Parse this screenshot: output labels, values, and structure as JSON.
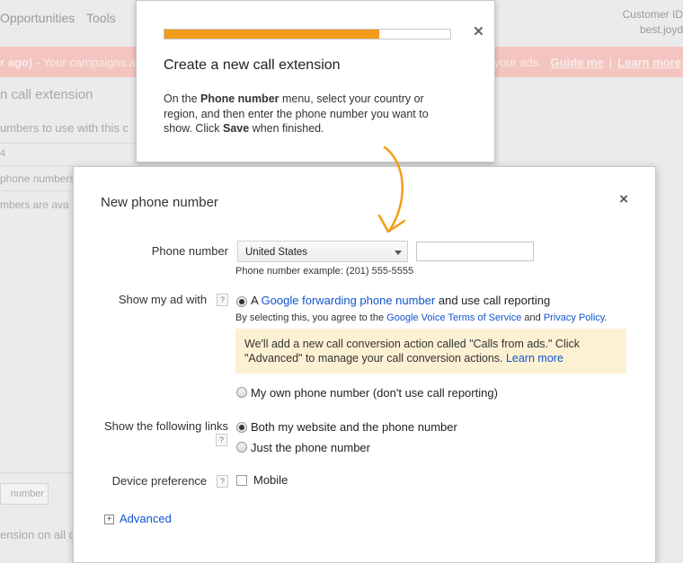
{
  "background": {
    "nav": [
      "Opportunities",
      "Tools"
    ],
    "customer": {
      "label": "Customer ID",
      "email": "best.joyd"
    },
    "alert": {
      "prefix": "r ago)",
      "text": " - Your campaigns a",
      "suffix": "your ads.",
      "guide_link": "Guide me",
      "learn_link": "Learn more"
    },
    "section_title": "n call extension",
    "desc": "umbers to use with this c",
    "row1": "4",
    "row2": "phone numbers",
    "row3": "mbers are ava",
    "btn": "number",
    "footer": "ension on all d"
  },
  "tooltip": {
    "progress_percent": 75,
    "title": "Create a new call extension",
    "body_1": "On the ",
    "body_bold_1": "Phone number",
    "body_2": " menu, select your country or region, and then enter the phone number you want to show. Click ",
    "body_bold_2": "Save",
    "body_3": " when finished.",
    "close_symbol": "×"
  },
  "dialog": {
    "title": "New phone number",
    "close_symbol": "×",
    "phone": {
      "label": "Phone number",
      "country": "United States",
      "input_value": "",
      "example": "Phone number example: (201) 555-5555"
    },
    "show_ad": {
      "label": "Show my ad with",
      "help": "?",
      "opt1_prefix": "A ",
      "opt1_link": "Google forwarding phone number",
      "opt1_suffix": " and use call reporting",
      "agree_prefix": "By selecting this, you agree to the ",
      "agree_link1": "Google Voice Terms of Service",
      "agree_mid": " and ",
      "agree_link2": "Privacy Policy",
      "agree_end": ".",
      "notice_text": "We'll add a new call conversion action called \"Calls from ads.\" Click \"Advanced\" to manage your call conversion actions. ",
      "notice_link": "Learn more",
      "opt2": "My own phone number (don't use call reporting)"
    },
    "links": {
      "label": "Show the following links",
      "help": "?",
      "opt1": "Both my website and the phone number",
      "opt2": "Just the phone number"
    },
    "device": {
      "label": "Device preference",
      "help": "?",
      "opt": "Mobile"
    },
    "advanced": {
      "symbol": "+",
      "label": "Advanced"
    }
  }
}
